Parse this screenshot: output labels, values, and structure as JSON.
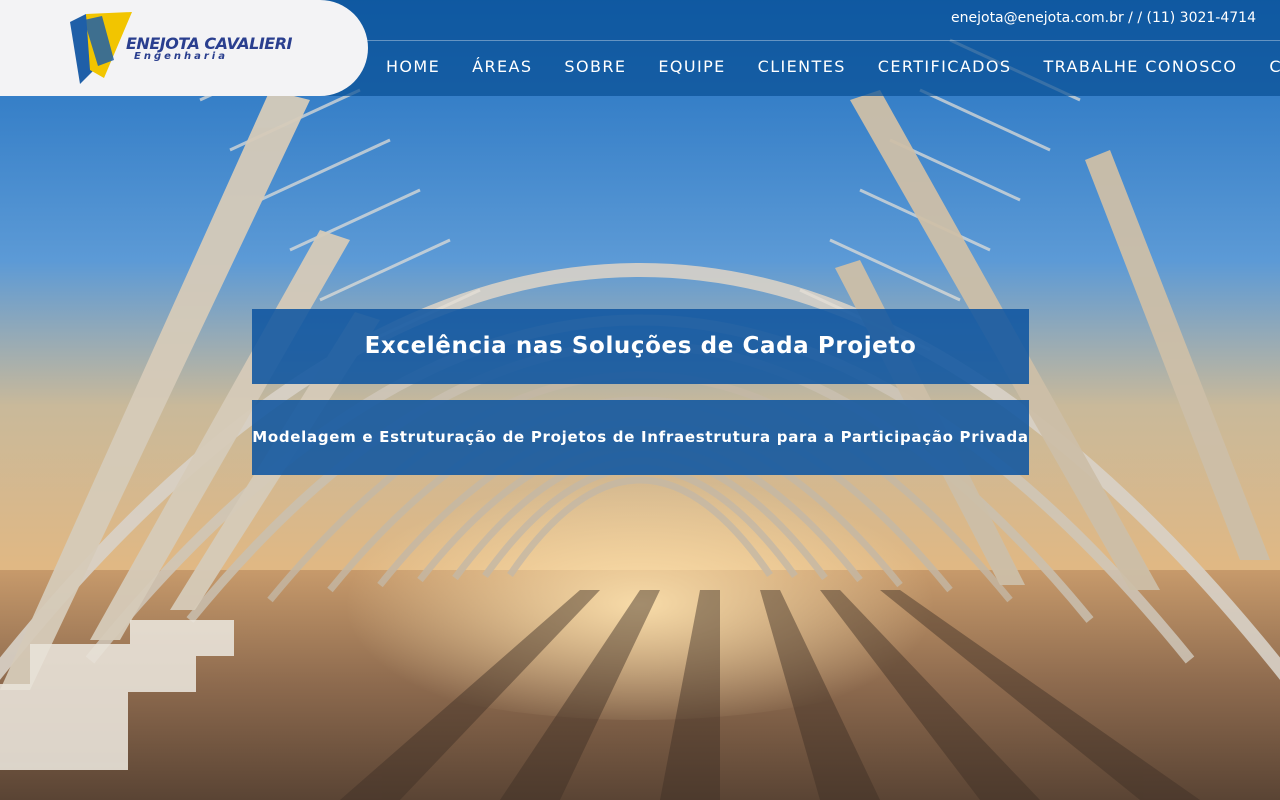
{
  "brand": {
    "name": "ENEJOTA CAVALIERI",
    "subtitle": "Engenharia",
    "logo_icon": "enejota-logo-mark",
    "colors": {
      "primary_blue": "#1f5fa8",
      "logo_yellow": "#f2c500",
      "logo_navy": "#2a3f8f"
    }
  },
  "header": {
    "contact": "enejota@enejota.com.br / / (11) 3021-4714"
  },
  "nav": {
    "items": [
      {
        "label": "HOME"
      },
      {
        "label": "ÁREAS"
      },
      {
        "label": "SOBRE"
      },
      {
        "label": "EQUIPE"
      },
      {
        "label": "CLIENTES"
      },
      {
        "label": "CERTIFICADOS"
      },
      {
        "label": "TRABALHE CONOSCO"
      },
      {
        "label": "CONTATO"
      }
    ]
  },
  "hero": {
    "title": "Excelência nas Soluções de Cada Projeto",
    "subtitle": "Modelagem e Estruturação de Projetos de Infraestrutura para a Participação Privada",
    "background": "architectural-arches-photo"
  }
}
